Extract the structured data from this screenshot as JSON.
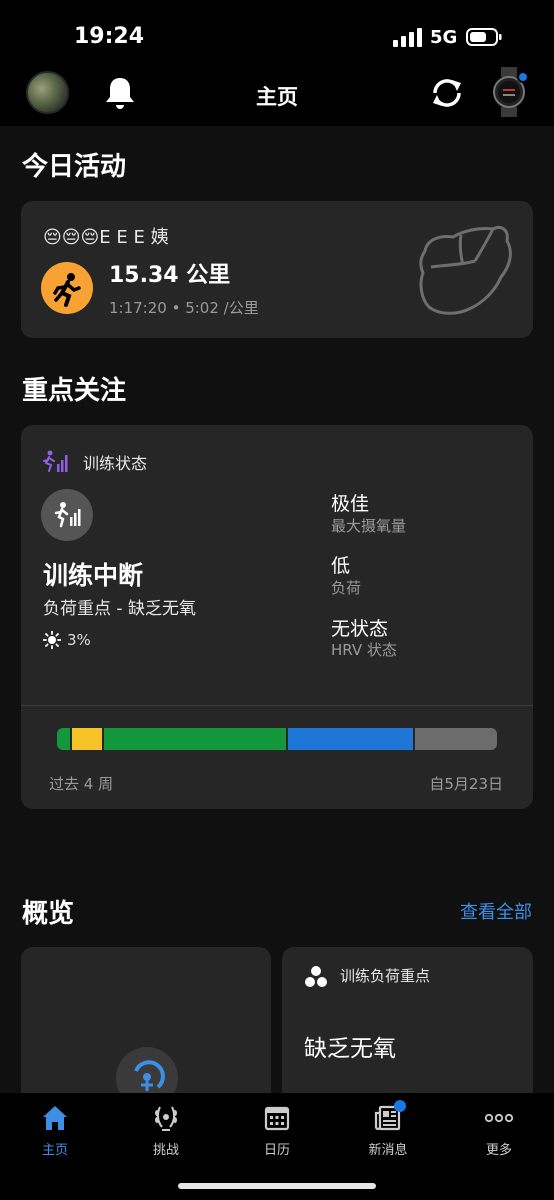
{
  "status_bar": {
    "time": "19:24",
    "network": "5G"
  },
  "header": {
    "title": "主页",
    "icons": [
      "avatar",
      "bell-icon",
      "sync-icon",
      "watch-icon"
    ]
  },
  "today": {
    "section_title": "今日活动",
    "activity": {
      "name": "😔😔😔E E E 姨",
      "distance": "15.34 公里",
      "meta": "1:17:20 • 5:02 /公里",
      "icon": "running-icon",
      "accent": "#f7a233"
    }
  },
  "focus": {
    "section_title": "重点关注",
    "card": {
      "label": "训练状态",
      "state": "训练中断",
      "subtitle": "负荷重点 - 缺乏无氧",
      "percent": "3%",
      "metrics": [
        {
          "value": "极佳",
          "label": "最大摄氧量"
        },
        {
          "value": "低",
          "label": "负荷"
        },
        {
          "value": "无状态",
          "label": "HRV 状态"
        }
      ],
      "bar_segments": [
        {
          "color": "#12983b",
          "fraction": 0.03
        },
        {
          "color": "#f5c227",
          "fraction": 0.07
        },
        {
          "color": "#12983b",
          "fraction": 0.42
        },
        {
          "color": "#1d76d6",
          "fraction": 0.29
        },
        {
          "color": "#6c6c6c",
          "fraction": 0.19
        }
      ],
      "footer_left": "过去 4 周",
      "footer_right": "自5月23日"
    }
  },
  "overview": {
    "section_title": "概览",
    "see_all": "查看全部",
    "tile2": {
      "label": "训练负荷重点",
      "value": "缺乏无氧"
    }
  },
  "nav": {
    "items": [
      {
        "label": "主页",
        "icon": "home-icon",
        "active": true
      },
      {
        "label": "挑战",
        "icon": "laurel-icon",
        "active": false
      },
      {
        "label": "日历",
        "icon": "calendar-icon",
        "active": false
      },
      {
        "label": "新消息",
        "icon": "news-icon",
        "active": false
      },
      {
        "label": "更多",
        "icon": "more-icon",
        "active": false
      }
    ]
  }
}
